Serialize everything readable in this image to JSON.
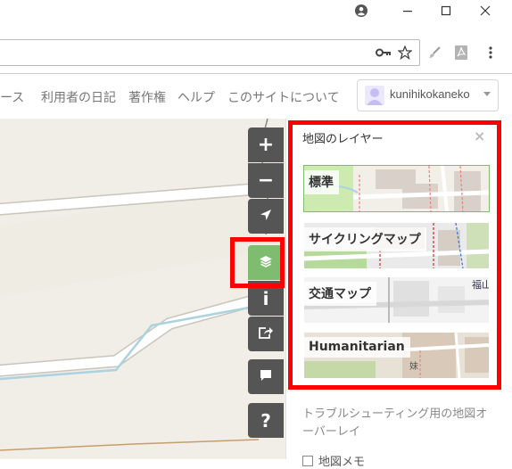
{
  "window": {
    "account_icon": "account-circle-icon",
    "minimize_icon": "minimize-icon",
    "maximize_icon": "maximize-icon",
    "close_icon": "close-icon"
  },
  "toolbar": {
    "key_icon": "key-icon",
    "star_icon": "star-icon",
    "brush_icon": "brush-icon",
    "pdf_icon": "pdf-icon",
    "menu_icon": "more-vert-icon"
  },
  "nav": {
    "items": [
      "ース",
      "利用者の日記",
      "著作権",
      "ヘルプ",
      "このサイトについて"
    ],
    "username": "kunihikokaneko"
  },
  "map_controls": [
    {
      "name": "zoom-in-button",
      "symbol": "+"
    },
    {
      "name": "zoom-out-button",
      "symbol": "−"
    },
    {
      "name": "locate-button",
      "icon": "location-arrow-icon"
    },
    {
      "name": "layers-button",
      "icon": "layers-icon",
      "active": true
    },
    {
      "name": "info-button",
      "symbol": "i"
    },
    {
      "name": "share-button",
      "icon": "share-icon"
    },
    {
      "name": "note-button",
      "icon": "comment-icon"
    },
    {
      "name": "query-button",
      "symbol": "?"
    }
  ],
  "layers_panel": {
    "title": "地図のレイヤー",
    "close": "×",
    "layers": [
      {
        "label": "標準",
        "selected": true
      },
      {
        "label": "サイクリングマップ",
        "selected": false
      },
      {
        "label": "交通マップ",
        "selected": false,
        "map_text": "福山"
      },
      {
        "label": "Humanitarian",
        "selected": false,
        "map_text": "妹"
      }
    ],
    "overlay_heading": "トラブルシューティング用の地図オーバーレイ",
    "overlay_item": "地図メモ"
  },
  "colors": {
    "control_bg": "#555555",
    "control_active": "#7ebc6f",
    "annotation": "#ff0000",
    "selected_border": "#7ebc6f"
  }
}
